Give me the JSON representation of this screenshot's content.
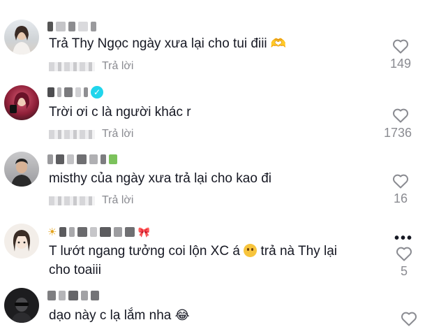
{
  "comments": [
    {
      "text": "Trả Thy Ngọc ngày xưa lại cho tui điii",
      "reply_label": "Trả lời",
      "likes": "149",
      "avatar_colors": [
        "#d9d1c7",
        "#3a2b25"
      ]
    },
    {
      "text": "Trời ơi c là người khác r",
      "reply_label": "Trả lời",
      "likes": "1736",
      "avatar_colors": [
        "#b8324d",
        "#1a1215"
      ]
    },
    {
      "text": "misthy của ngày xưa trả lại cho kao đi",
      "reply_label": "Trả lời",
      "likes": "16",
      "avatar_colors": [
        "#a8a8aa",
        "#2a2a2a"
      ]
    },
    {
      "text": "T lướt ngang tưởng coi lộn XC á",
      "text_after": " trả nà Thy lại\ncho toaiii",
      "likes": "5",
      "avatar_colors": [
        "#ece3da",
        "#3a2d26"
      ]
    },
    {
      "text": "dạo này c lạ lắm nha",
      "avatar_colors": [
        "#1d1d1f",
        "#6e6e70"
      ]
    }
  ],
  "icons": {
    "like": "heart-outline-icon",
    "more": "more-dots-icon",
    "verified": "verified-badge-icon",
    "emoji_smile": "smile-emoji",
    "emoji_laugh": "laugh-emoji",
    "emoji_heart_hands": "heart-hands-emoji"
  },
  "colors": {
    "text": "#161823",
    "secondary": "#8a8b91",
    "verified": "#20d5ec"
  }
}
